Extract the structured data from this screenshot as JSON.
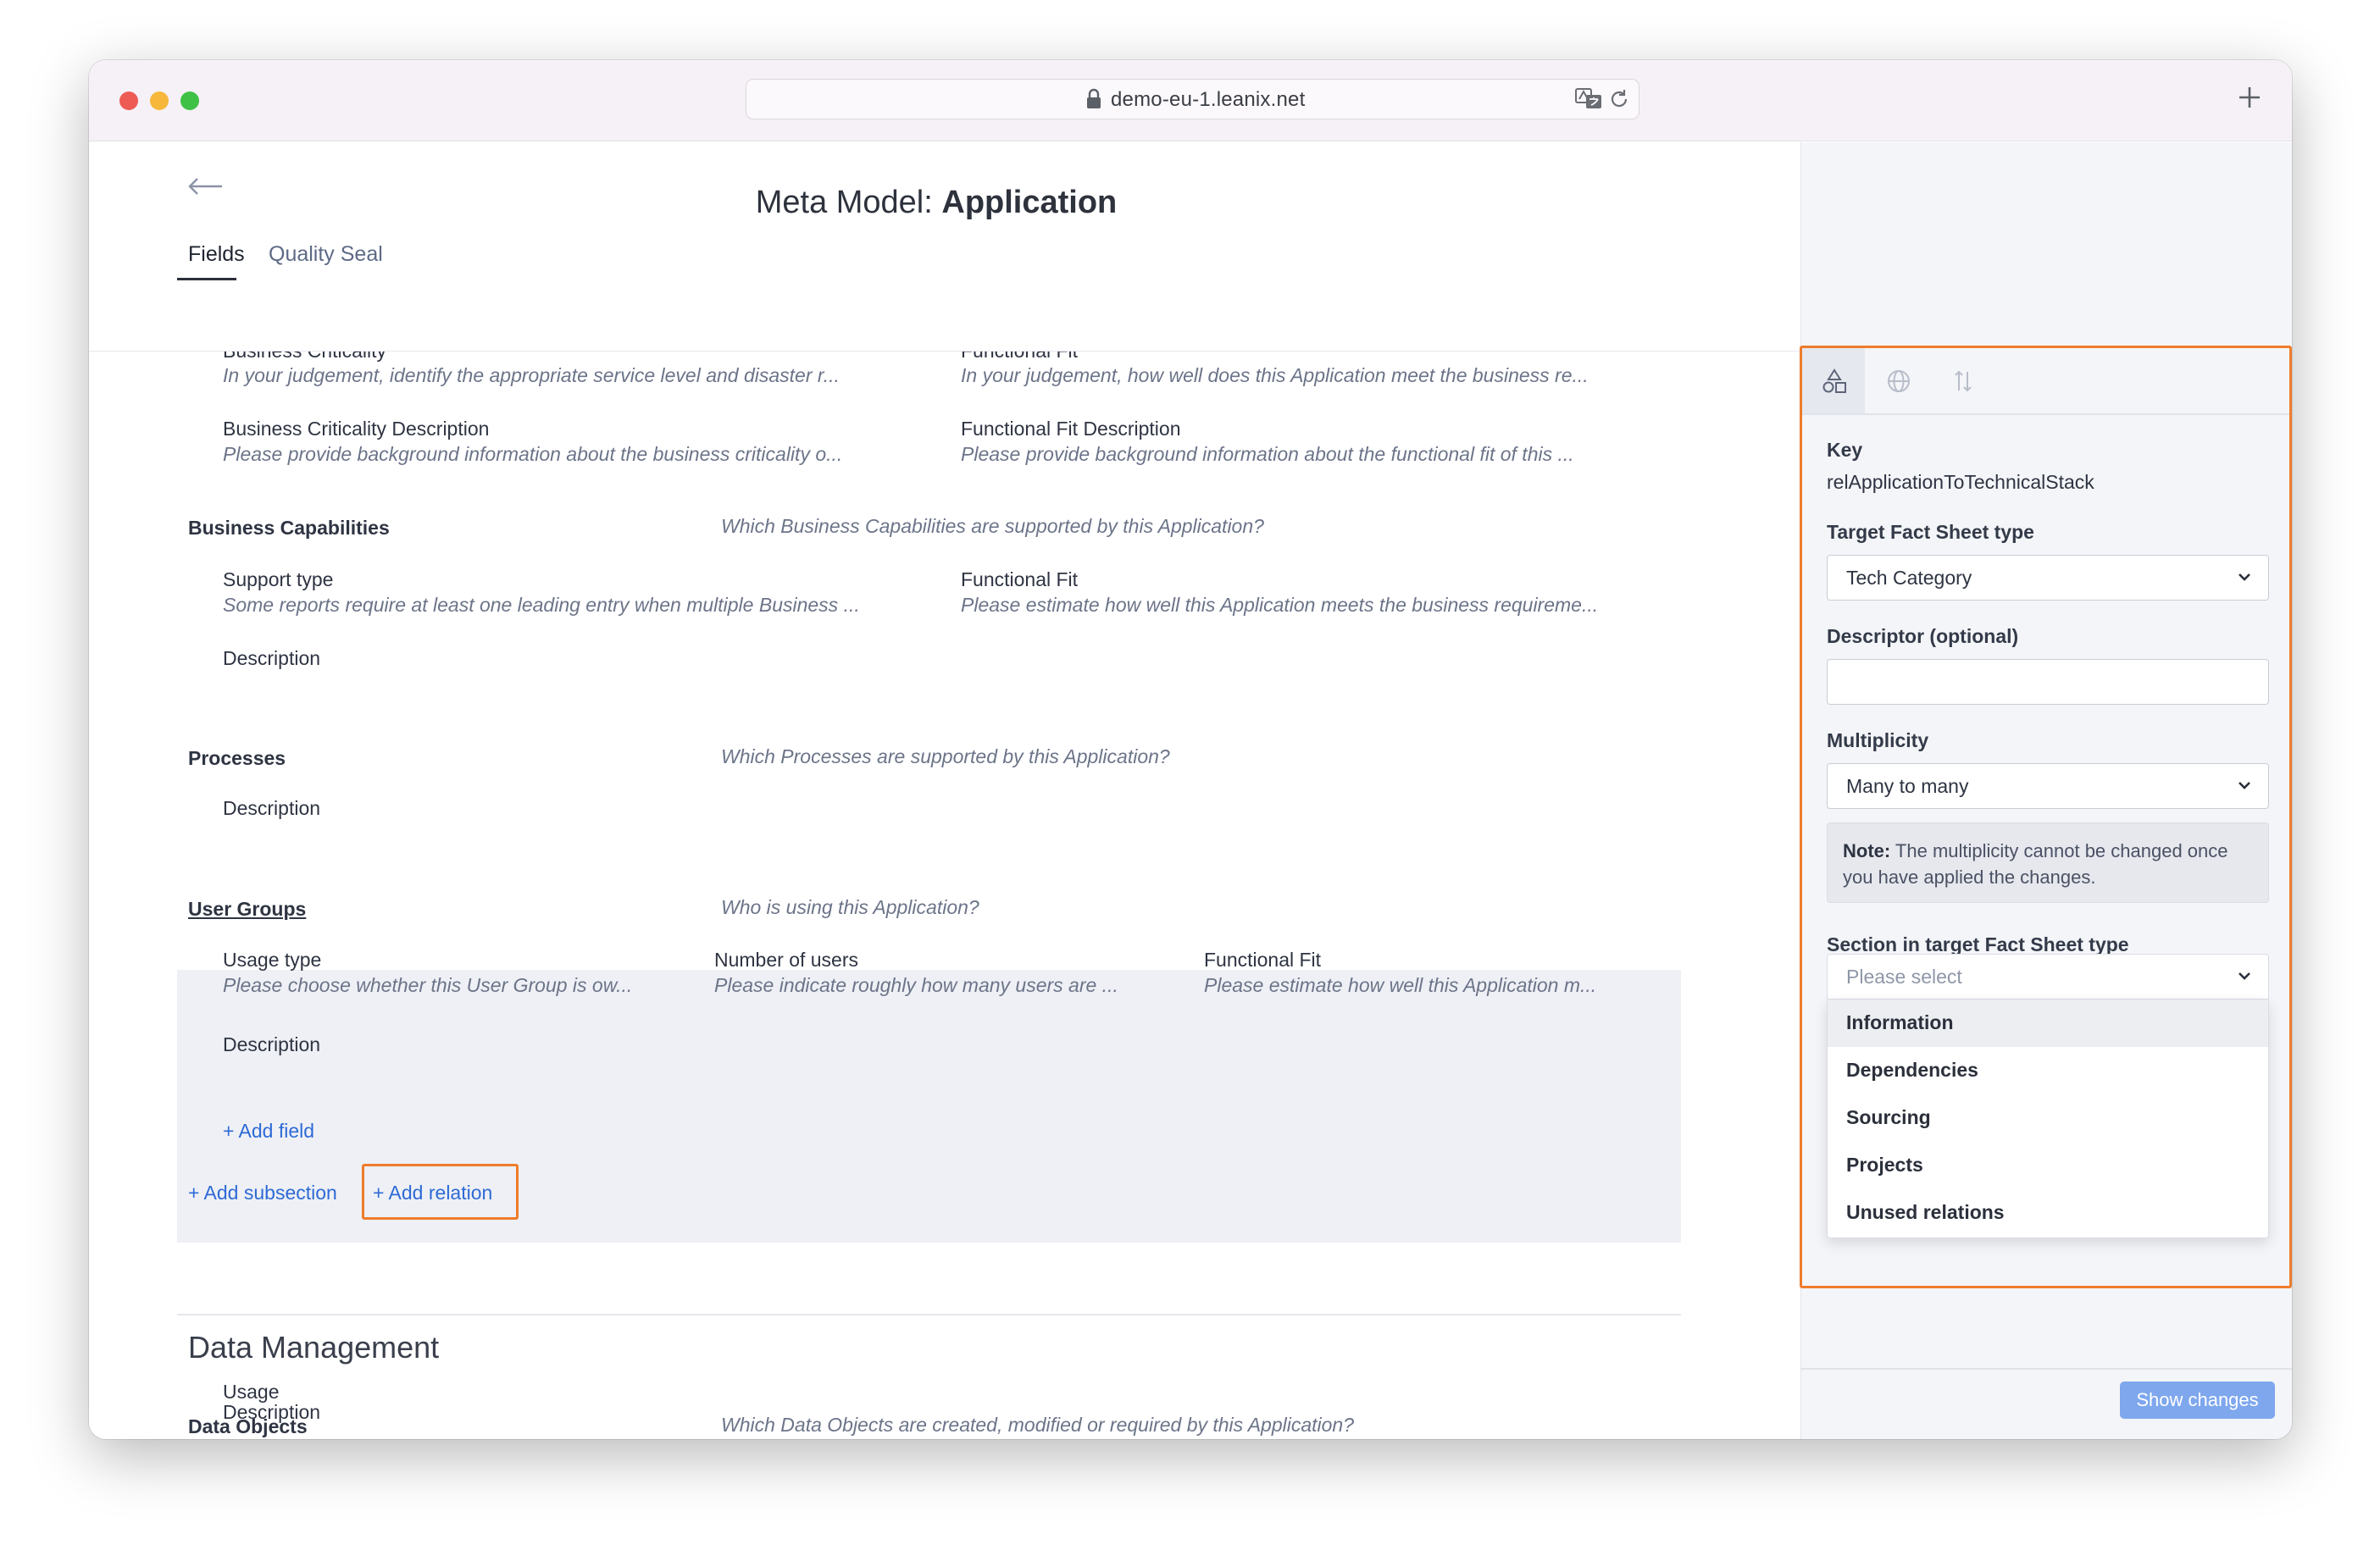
{
  "browser": {
    "url": "demo-eu-1.leanix.net"
  },
  "page": {
    "title_prefix": "Meta Model: ",
    "title_strong": "Application",
    "tabs": [
      {
        "label": "Fields"
      },
      {
        "label": "Quality Seal"
      }
    ]
  },
  "sections": {
    "top_cut": {
      "left_label": "Business Criticality",
      "left_desc": "In your judgement, identify the appropriate service level and disaster r...",
      "right_label": "Functional Fit",
      "right_desc": "In your judgement, how well does this Application meet the business re..."
    },
    "criticality_desc": {
      "left_label": "Business Criticality Description",
      "left_desc": "Please provide background information about the business criticality o...",
      "right_label": "Functional Fit Description",
      "right_desc": "Please provide background information about the functional fit of this ..."
    },
    "business_capabilities": {
      "title": "Business Capabilities",
      "question": "Which Business Capabilities are supported by this Application?",
      "field1_label": "Support type",
      "field1_desc": "Some reports require at least one leading entry when multiple Business ...",
      "field2_label": "Functional Fit",
      "field2_desc": "Please estimate how well this Application meets the business requireme...",
      "description_label": "Description"
    },
    "processes": {
      "title": "Processes",
      "question": "Which Processes are supported by this Application?",
      "description_label": "Description"
    },
    "user_groups": {
      "title": "User Groups",
      "question": "Who is using this Application?",
      "field1_label": "Usage type",
      "field1_desc": "Please choose whether this User Group is ow...",
      "field2_label": "Number of users",
      "field2_desc": "Please indicate roughly how many users are ...",
      "field3_label": "Functional Fit",
      "field3_desc": "Please estimate how well this Application m...",
      "description_label": "Description",
      "add_field": "+ Add field"
    },
    "actions": {
      "add_subsection": "+ Add subsection",
      "add_relation": "+ Add relation"
    },
    "data_management": {
      "heading": "Data Management",
      "data_objects_title": "Data Objects",
      "data_objects_question": "Which Data Objects are created, modified or required by this Application?",
      "usage_label": "Usage",
      "description_label": "Description"
    }
  },
  "panel": {
    "tab_icons": [
      "shapes-icon",
      "globe-icon",
      "sort-icon"
    ],
    "key_label": "Key",
    "key_value": "relApplicationToTechnicalStack",
    "target_label": "Target Fact Sheet type",
    "target_value": "Tech Category",
    "descriptor_label": "Descriptor (optional)",
    "descriptor_value": "",
    "multiplicity_label": "Multiplicity",
    "multiplicity_value": "Many to many",
    "note_strong": "Note:",
    "note_text": " The multiplicity cannot be changed once you have applied the changes.",
    "section_label": "Section in target Fact Sheet type",
    "section_placeholder": "Please select",
    "section_options": [
      "Information",
      "Dependencies",
      "Sourcing",
      "Projects",
      "Unused relations"
    ],
    "show_changes": "Show changes"
  },
  "colors": {
    "highlight": "#ef7c2c",
    "link": "#2e6ad6",
    "button": "#7ea7ee"
  }
}
